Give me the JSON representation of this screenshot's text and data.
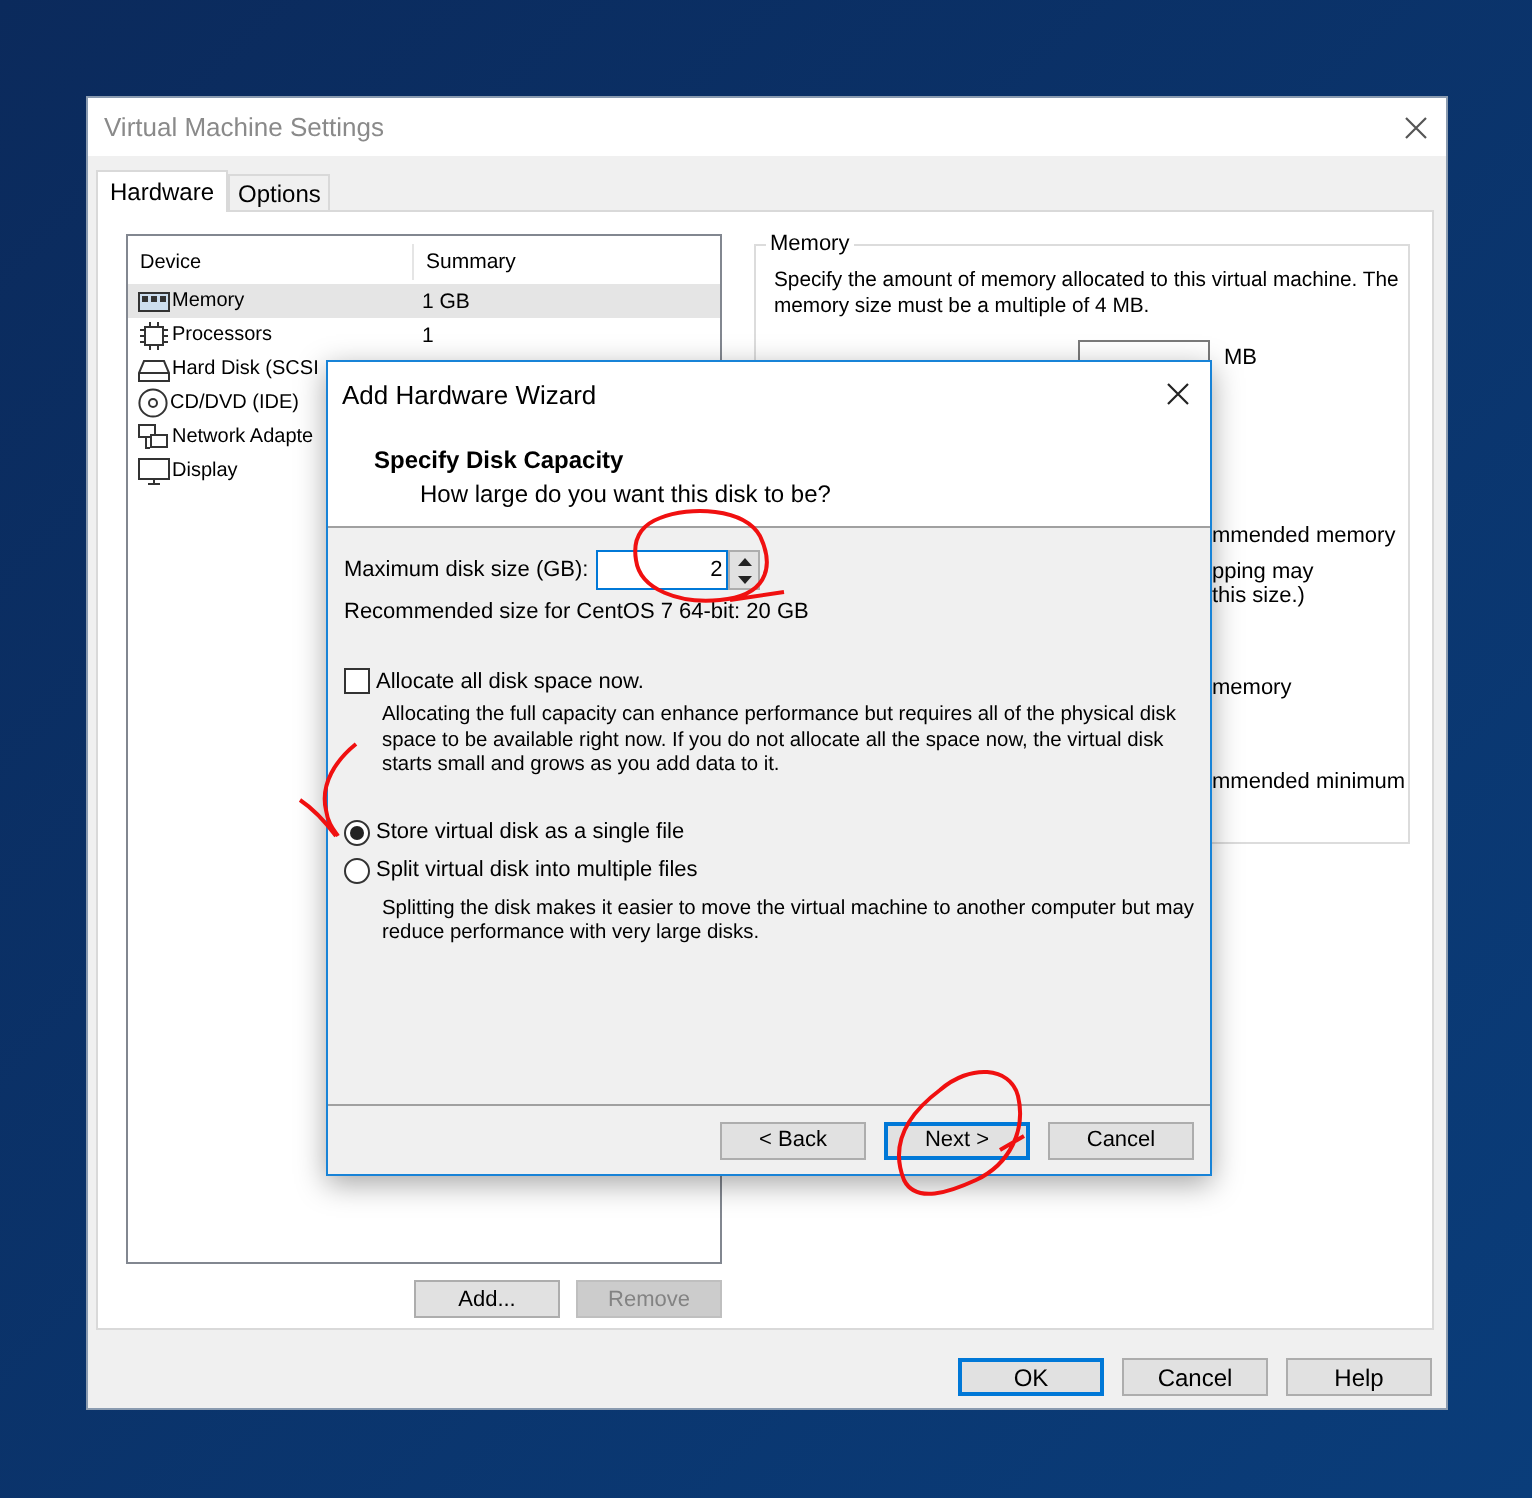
{
  "window": {
    "title": "Virtual Machine Settings"
  },
  "tabs": [
    {
      "label": "Hardware",
      "selected": true
    },
    {
      "label": "Options",
      "selected": false
    }
  ],
  "device_list": {
    "columns": [
      "Device",
      "Summary"
    ],
    "rows": [
      {
        "kind": "memory",
        "device": "Memory",
        "summary": "1 GB",
        "selected": true
      },
      {
        "kind": "processor",
        "device": "Processors",
        "summary": "1",
        "selected": false
      },
      {
        "kind": "disk",
        "device": "Hard Disk (SCSI",
        "selected": false
      },
      {
        "kind": "cd",
        "device": "CD/DVD (IDE)",
        "selected": false
      },
      {
        "kind": "network",
        "device": "Network Adapte",
        "selected": false
      },
      {
        "kind": "display",
        "device": "Display",
        "selected": false
      }
    ]
  },
  "device_buttons": [
    {
      "label": "Add...",
      "disabled": false
    },
    {
      "label": "Remove",
      "disabled": true
    }
  ],
  "memory_panel": {
    "title": "Memory",
    "description": "Specify the amount of memory allocated to this virtual machine. The memory size must be a multiple of 4 MB.",
    "unit": "MB",
    "fragments": [
      "mmended memory",
      "pping may",
      "this size.)",
      "memory",
      "mmended minimum"
    ]
  },
  "wizard": {
    "title": "Add Hardware Wizard",
    "heading": "Specify Disk Capacity",
    "subheading": "How large do you want this disk to be?",
    "size_label": "Maximum disk size (GB):",
    "size_value": "2",
    "recommendation": "Recommended size for CentOS 7 64-bit: 20 GB",
    "allocate": {
      "label": "Allocate all disk space now.",
      "checked": false,
      "description": "Allocating the full capacity can enhance performance but requires all of the physical disk space to be available right now. If you do not allocate all the space now, the virtual disk starts small and grows as you add data to it."
    },
    "disk_files": [
      {
        "label": "Store virtual disk as a single file",
        "selected": true
      },
      {
        "label": "Split virtual disk into multiple files",
        "selected": false
      }
    ],
    "split_description": "Splitting the disk makes it easier to move the virtual machine to another computer but may reduce performance with very large disks.",
    "buttons": [
      {
        "label": "< Back",
        "focused": false
      },
      {
        "label": "Next >",
        "focused": true
      },
      {
        "label": "Cancel",
        "focused": false
      }
    ]
  },
  "dialog_buttons": [
    {
      "label": "OK",
      "focused": true
    },
    {
      "label": "Cancel",
      "focused": false
    },
    {
      "label": "Help",
      "focused": false
    }
  ]
}
